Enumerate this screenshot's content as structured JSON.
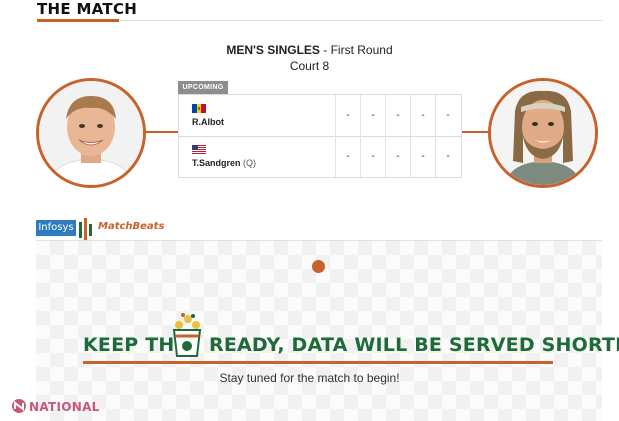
{
  "section": {
    "title": "THE MATCH"
  },
  "match": {
    "category": "MEN'S SINGLES",
    "separator": " - ",
    "round": "First Round",
    "court": "Court 8",
    "status": "UPCOMING"
  },
  "players": [
    {
      "name": "R.Albot",
      "seed": "",
      "flag": "moldova-flag-icon",
      "scores": [
        "-",
        "-",
        "-",
        "-",
        "-"
      ]
    },
    {
      "name": "T.Sandgren",
      "seed": "(Q)",
      "flag": "usa-flag-icon",
      "scores": [
        "-",
        "-",
        "-",
        "-",
        "-"
      ]
    }
  ],
  "brand": {
    "infosys": "Infosys",
    "matchbeats": "MatchBeats"
  },
  "placeholder": {
    "headline_left": "KEEP THE",
    "headline_right": "READY, DATA WILL BE SERVED SHORTLY.",
    "subtext": "Stay tuned for the match to begin!"
  },
  "watermark": {
    "text": "NATIONAL"
  },
  "colors": {
    "accent": "#c9612a",
    "headline": "#1e6b3a",
    "badge": "#8e8e8e",
    "infosys": "#2f7bbf"
  }
}
